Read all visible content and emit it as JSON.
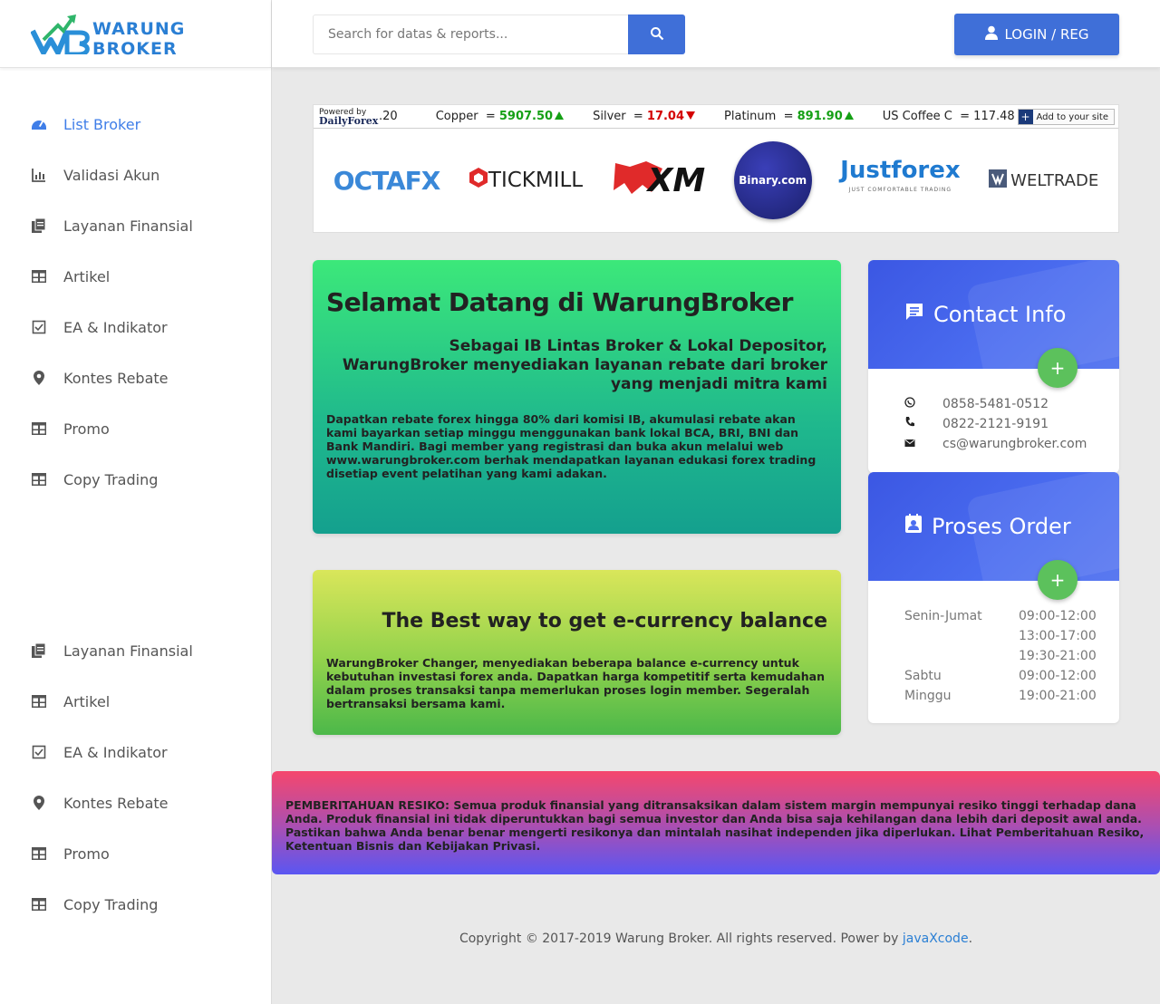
{
  "logo": {
    "text": "WARUNG BROKER"
  },
  "header": {
    "search_placeholder": "Search for datas & reports...",
    "login_label": "LOGIN / REG"
  },
  "nav_top": [
    {
      "label": "List Broker",
      "icon": "dashboard-icon",
      "active": true
    },
    {
      "label": "Validasi Akun",
      "icon": "bar-chart-icon"
    },
    {
      "label": "Layanan Finansial",
      "icon": "documents-icon"
    },
    {
      "label": "Artikel",
      "icon": "table-icon"
    },
    {
      "label": "EA & Indikator",
      "icon": "checkbox-icon"
    },
    {
      "label": "Kontes Rebate",
      "icon": "location-pin-icon"
    },
    {
      "label": "Promo",
      "icon": "table-icon"
    },
    {
      "label": "Copy Trading",
      "icon": "table-icon"
    }
  ],
  "nav_bottom": [
    {
      "label": "Layanan Finansial",
      "icon": "documents-icon"
    },
    {
      "label": "Artikel",
      "icon": "table-icon"
    },
    {
      "label": "EA & Indikator",
      "icon": "checkbox-icon"
    },
    {
      "label": "Kontes Rebate",
      "icon": "location-pin-icon"
    },
    {
      "label": "Promo",
      "icon": "table-icon"
    },
    {
      "label": "Copy Trading",
      "icon": "table-icon"
    }
  ],
  "ticker": {
    "powered_by": "Powered by",
    "powered_brand": "DailyForex",
    "lead": ".20",
    "items": [
      {
        "name": "Copper",
        "value": "5907.50",
        "dir": "up"
      },
      {
        "name": "Silver",
        "value": "17.04",
        "dir": "down"
      },
      {
        "name": "Platinum",
        "value": "891.90",
        "dir": "up"
      },
      {
        "name": "US Coffee C",
        "value": "117.48",
        "dir": "flat"
      }
    ],
    "add_label": "Add to your site"
  },
  "brokers": {
    "octafx": "OCTAFX",
    "tickmill": "TICKMILL",
    "xm": "XM",
    "binary": "Binary.com",
    "justforex": "Justforex",
    "justforex_tag": "JUST COMFORTABLE TRADING",
    "weltrade": "WELTRADE"
  },
  "welcome": {
    "title": "Selamat Datang di WarungBroker",
    "subtitle": "Sebagai IB Lintas Broker & Lokal Depositor, WarungBroker menyediakan layanan rebate dari broker yang menjadi mitra kami",
    "body": "Dapatkan rebate forex hingga 80% dari komisi IB, akumulasi rebate akan kami bayarkan setiap minggu menggunakan bank lokal BCA, BRI, BNI dan Bank Mandiri. Bagi member yang registrasi dan buka akun melalui web www.warungbroker.com berhak mendapatkan layanan edukasi forex trading disetiap event pelatihan yang kami adakan."
  },
  "ecurrency": {
    "title": "The Best way to get e-currency balance",
    "body": "WarungBroker Changer, menyediakan beberapa balance e-currency untuk kebutuhan investasi forex anda. Dapatkan harga kompetitif serta kemudahan dalam proses transaksi tanpa memerlukan proses login member. Segeralah bertransaksi bersama kami."
  },
  "contact": {
    "title": "Contact Info",
    "fab": "+",
    "whatsapp": "0858-5481-0512",
    "phone": "0822-2121-9191",
    "email": "cs@warungbroker.com"
  },
  "order": {
    "title": "Proses Order",
    "fab": "+",
    "rows": [
      {
        "day": "Senin-Jumat",
        "time": "09:00-12:00"
      },
      {
        "day": "",
        "time": "13:00-17:00"
      },
      {
        "day": "",
        "time": "19:30-21:00"
      },
      {
        "day": "Sabtu",
        "time": "09:00-12:00"
      },
      {
        "day": "Minggu",
        "time": "19:00-21:00"
      }
    ]
  },
  "risk": {
    "text": "PEMBERITAHUAN RESIKO: Semua produk finansial yang ditransaksikan dalam sistem margin mempunyai resiko tinggi terhadap dana Anda. Produk finansial ini tidak diperuntukkan bagi semua investor dan Anda bisa saja kehilangan dana lebih dari deposit awal anda. Pastikan bahwa Anda benar benar mengerti resikonya dan mintalah nasihat independen jika diperlukan. Lihat Pemberitahuan Resiko, Ketentuan Bisnis dan Kebijakan Privasi."
  },
  "footer": {
    "text": "Copyright © 2017-2019 Warung Broker. All rights reserved. Power by ",
    "link": "javaXcode",
    "end": "."
  },
  "colors": {
    "accent": "#3f6fd8",
    "active_nav": "#3f7ee8",
    "fab": "#5cc15c"
  }
}
